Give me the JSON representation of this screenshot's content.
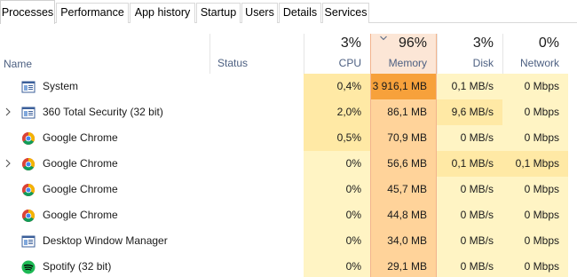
{
  "tabs": [
    "Processes",
    "Performance",
    "App history",
    "Startup",
    "Users",
    "Details",
    "Services"
  ],
  "header": {
    "name": "Name",
    "status": "Status",
    "cpu": {
      "percent": "3%",
      "label": "CPU"
    },
    "memory": {
      "percent": "96%",
      "label": "Memory"
    },
    "disk": {
      "percent": "3%",
      "label": "Disk"
    },
    "network": {
      "percent": "0%",
      "label": "Network"
    }
  },
  "processes": [
    {
      "name": "System",
      "icon": "window-icon",
      "expandable": false,
      "cpu": "0,4%",
      "memory": "3 916,1 MB",
      "disk": "0,1 MB/s",
      "network": "0 Mbps"
    },
    {
      "name": "360 Total Security (32 bit)",
      "icon": "window-icon",
      "expandable": true,
      "cpu": "2,0%",
      "memory": "86,1 MB",
      "disk": "9,6 MB/s",
      "network": "0 Mbps"
    },
    {
      "name": "Google Chrome",
      "icon": "chrome-icon",
      "expandable": false,
      "cpu": "0,5%",
      "memory": "70,9 MB",
      "disk": "0 MB/s",
      "network": "0 Mbps"
    },
    {
      "name": "Google Chrome",
      "icon": "chrome-icon",
      "expandable": true,
      "cpu": "0%",
      "memory": "56,6 MB",
      "disk": "0,1 MB/s",
      "network": "0,1 Mbps"
    },
    {
      "name": "Google Chrome",
      "icon": "chrome-icon",
      "expandable": false,
      "cpu": "0%",
      "memory": "45,7 MB",
      "disk": "0 MB/s",
      "network": "0 Mbps"
    },
    {
      "name": "Google Chrome",
      "icon": "chrome-icon",
      "expandable": false,
      "cpu": "0%",
      "memory": "44,8 MB",
      "disk": "0 MB/s",
      "network": "0 Mbps"
    },
    {
      "name": "Desktop Window Manager",
      "icon": "window-icon",
      "expandable": false,
      "cpu": "0%",
      "memory": "34,0 MB",
      "disk": "0 MB/s",
      "network": "0 Mbps"
    },
    {
      "name": "Spotify (32 bit)",
      "icon": "spotify-icon",
      "expandable": false,
      "cpu": "0%",
      "memory": "29,1 MB",
      "disk": "0 MB/s",
      "network": "0 Mbps"
    }
  ],
  "colors": {
    "accent_memory": "#f7a13b",
    "heat_light": "#fff4c4",
    "heat_medium": "#ffe9a5",
    "memory_border": "#f2b48e"
  }
}
